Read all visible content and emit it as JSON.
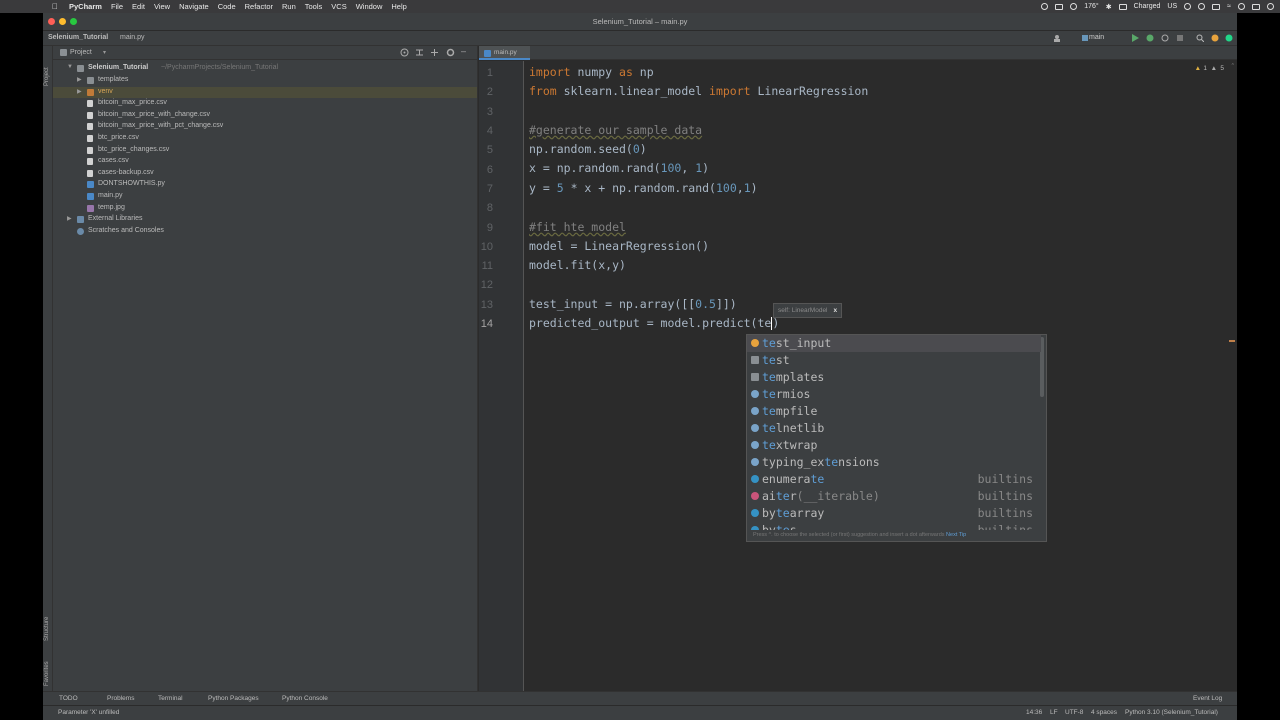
{
  "menubar": {
    "app": "PyCharm",
    "items": [
      "File",
      "Edit",
      "View",
      "Navigate",
      "Code",
      "Refactor",
      "Run",
      "Tools",
      "VCS",
      "Window",
      "Help"
    ],
    "temp": "176°",
    "battery": "Charged",
    "keyboard": "US"
  },
  "window": {
    "title": "Selenium_Tutorial – main.py",
    "breadcrumb_project": "Selenium_Tutorial",
    "breadcrumb_file": "main.py",
    "branch": "main"
  },
  "project": {
    "header": "Project",
    "root": "Selenium_Tutorial",
    "root_path": "~/PycharmProjects/Selenium_Tutorial",
    "items": [
      {
        "label": "templates",
        "kind": "folder"
      },
      {
        "label": "venv",
        "kind": "folder-excluded"
      },
      {
        "label": "bitcoin_max_price.csv",
        "kind": "csv"
      },
      {
        "label": "bitcoin_max_price_with_change.csv",
        "kind": "csv"
      },
      {
        "label": "bitcoin_max_price_with_pct_change.csv",
        "kind": "csv"
      },
      {
        "label": "btc_price.csv",
        "kind": "csv"
      },
      {
        "label": "btc_price_changes.csv",
        "kind": "csv"
      },
      {
        "label": "cases.csv",
        "kind": "csv"
      },
      {
        "label": "cases-backup.csv",
        "kind": "csv"
      },
      {
        "label": "DONTSHOWTHIS.py",
        "kind": "py"
      },
      {
        "label": "main.py",
        "kind": "py"
      },
      {
        "label": "temp.jpg",
        "kind": "img"
      }
    ],
    "external": "External Libraries",
    "scratches": "Scratches and Consoles"
  },
  "editor": {
    "tab": "main.py",
    "warnings": "1",
    "weak_warnings": "5",
    "line_numbers": [
      "1",
      "2",
      "3",
      "4",
      "5",
      "6",
      "7",
      "8",
      "9",
      "10",
      "11",
      "12",
      "13",
      "14"
    ],
    "hint_param": "self: LinearModel",
    "hint_close": "x"
  },
  "completion": {
    "typed": "te",
    "items": [
      {
        "pre": "",
        "match": "te",
        "post": "st_input",
        "type": "",
        "icon": "variable-icon"
      },
      {
        "pre": "",
        "match": "te",
        "post": "st",
        "type": "",
        "icon": "package-icon"
      },
      {
        "pre": "",
        "match": "te",
        "post": "mplates",
        "type": "",
        "icon": "folder-icon"
      },
      {
        "pre": "",
        "match": "te",
        "post": "rmios",
        "type": "",
        "icon": "module-icon"
      },
      {
        "pre": "",
        "match": "te",
        "post": "mpfile",
        "type": "",
        "icon": "module-icon"
      },
      {
        "pre": "",
        "match": "te",
        "post": "lnetlib",
        "type": "",
        "icon": "module-icon"
      },
      {
        "pre": "",
        "match": "te",
        "post": "xtwrap",
        "type": "",
        "icon": "module-icon"
      },
      {
        "pre": "typing_ex",
        "match": "te",
        "post": "nsions",
        "type": "",
        "icon": "module-icon"
      },
      {
        "pre": "enumera",
        "match": "te",
        "post": "",
        "type": "builtins",
        "icon": "class-icon"
      },
      {
        "pre": "ai",
        "match": "te",
        "post": "r(__iterable)",
        "type": "builtins",
        "icon": "function-icon"
      },
      {
        "pre": "by",
        "match": "te",
        "post": "array",
        "type": "builtins",
        "icon": "class-icon"
      },
      {
        "pre": "by",
        "match": "te",
        "post": "s",
        "type": "builtins",
        "icon": "class-icon"
      }
    ],
    "footer": "Press ^. to choose the selected (or first) suggestion and insert a dot afterwards",
    "next_tip": "Next Tip"
  },
  "toolwindows": [
    "TODO",
    "Problems",
    "Terminal",
    "Python Packages",
    "Python Console"
  ],
  "event_log": "Event Log",
  "sidebar_labels": {
    "project": "Project",
    "structure": "Structure",
    "favorites": "Favorites"
  },
  "status": {
    "message": "Parameter 'X' unfilled",
    "position": "14:36",
    "line_sep": "LF",
    "encoding": "UTF-8",
    "indent": "4 spaces",
    "interpreter": "Python 3.10 (Selenium_Tutorial)"
  },
  "colors": {
    "accent": "#4a88c7",
    "keyword": "#cc7832",
    "number": "#6897bb",
    "match": "#5f9ed6"
  }
}
